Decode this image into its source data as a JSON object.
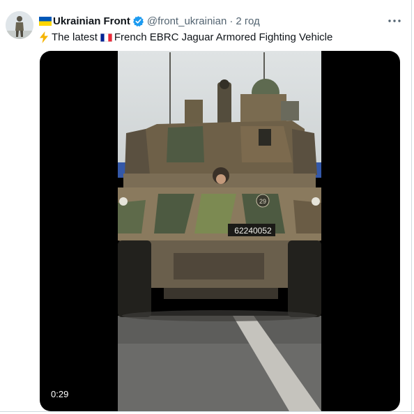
{
  "tweet": {
    "author_name": "Ukrainian Front",
    "author_handle": "@front_ukrainian",
    "separator": "·",
    "timestamp": "2 год",
    "text_part1": "The latest",
    "text_part2": "French EBRC Jaguar Armored Fighting Vehicle"
  },
  "media": {
    "duration": "0:29",
    "plate_number": "62240052",
    "marking": "29"
  },
  "icons": {
    "avatar": "avatar-soldier-image",
    "flag_before_name": "ukraine-flag-emoji",
    "verified": "verified-badge-icon",
    "more": "more-options-icon",
    "bolt": "lightning-bolt-emoji",
    "flag_in_text": "france-flag-emoji"
  },
  "colors": {
    "text_primary": "#0f1419",
    "text_secondary": "#536471",
    "verified_blue": "#1d9bf0",
    "border": "#cfd9de",
    "media_background": "#000000"
  }
}
